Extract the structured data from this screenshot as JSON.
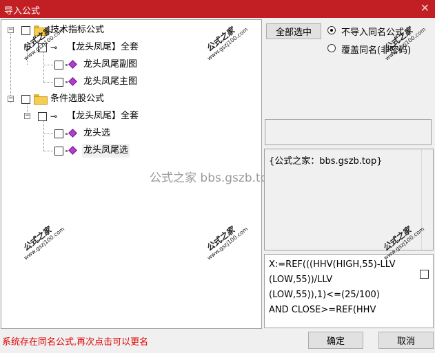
{
  "window": {
    "title": "导入公式",
    "close_glyph": "✕"
  },
  "tree": {
    "group1": {
      "label": "技术指标公式",
      "expander": "−",
      "set": {
        "label": "【龙头凤尾】全套",
        "expander": "−"
      },
      "items": [
        "龙头凤尾副图",
        "龙头凤尾主图"
      ]
    },
    "group2": {
      "label": "条件选股公式",
      "expander": "−",
      "set": {
        "label": "【龙头凤尾】全套",
        "expander": "−"
      },
      "items": [
        "龙头选",
        "龙头凤尾选"
      ]
    }
  },
  "options": {
    "select_all_label": "全部选中",
    "radio_skip_label": "不导入同名公式",
    "radio_overwrite_label": "覆盖同名(非密码)",
    "selected": "skip"
  },
  "description": "{公式之家：bbs.gszb.top}",
  "code": [
    "X:=REF(((HHV(HIGH,55)-LLV",
    "(LOW,55))/LLV",
    "(LOW,55)),1)<=(25/100)",
    "AND CLOSE>=REF(HHV"
  ],
  "watermark": {
    "center_text": "公式之家 bbs.gszb.top",
    "tag_cn": "公式之家",
    "tag_url": "www.gszj100.com"
  },
  "status": "系统存在同名公式,再次点击可以更名",
  "buttons": {
    "ok": "确定",
    "cancel": "取消"
  },
  "icons": {
    "expander": "tree-expander-icon",
    "folder": "folder-icon",
    "key": "key-icon",
    "formula": "formula-gem-icon"
  },
  "colors": {
    "titlebar": "#c21f24",
    "status_text": "#e00000",
    "formula_icon": "#b43bd1",
    "folder": "#f5cd4f"
  }
}
